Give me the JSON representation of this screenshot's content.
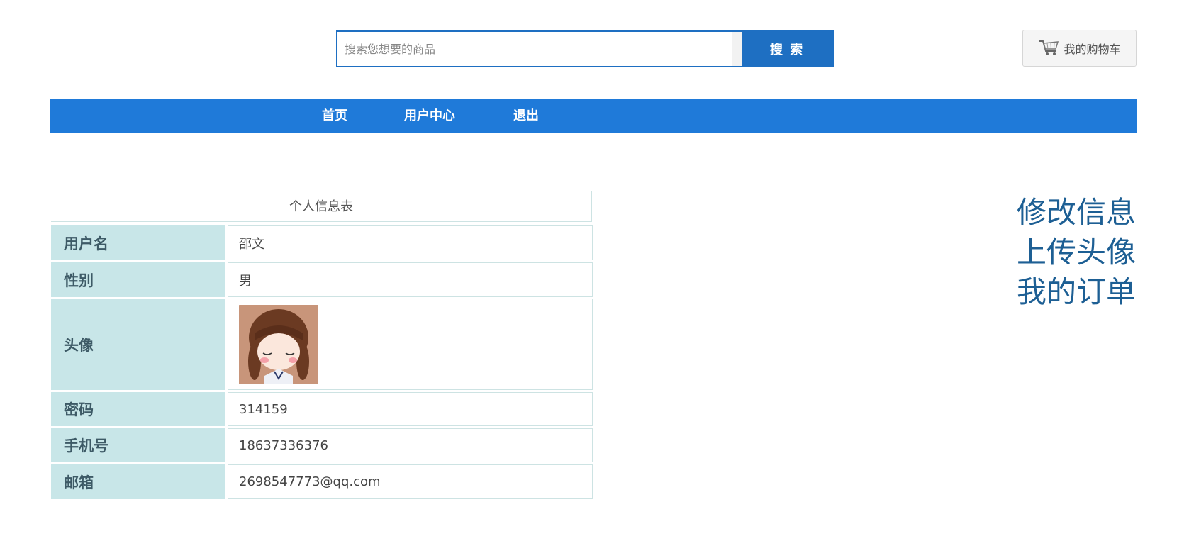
{
  "search": {
    "placeholder": "搜索您想要的商品",
    "button_label": "搜 索"
  },
  "cart": {
    "label": "我的购物车",
    "icon": "cart-icon"
  },
  "nav": {
    "items": [
      {
        "label": "首页"
      },
      {
        "label": "用户中心"
      },
      {
        "label": "退出"
      }
    ]
  },
  "profile": {
    "caption": "个人信息表",
    "rows": [
      {
        "label": "用户名",
        "value": "邵文"
      },
      {
        "label": "性别",
        "value": "男"
      },
      {
        "label": "头像",
        "value": ""
      },
      {
        "label": "密码",
        "value": "314159"
      },
      {
        "label": "手机号",
        "value": "18637336376"
      },
      {
        "label": "邮箱",
        "value": "2698547773@qq.com"
      }
    ]
  },
  "side_links": [
    {
      "label": "修改信息"
    },
    {
      "label": "上传头像"
    },
    {
      "label": "我的订单"
    }
  ],
  "colors": {
    "accent": "#1f7ad9",
    "search_border": "#1e6fc2",
    "label_bg": "#c8e6e8",
    "side_link": "#1d5f94"
  }
}
